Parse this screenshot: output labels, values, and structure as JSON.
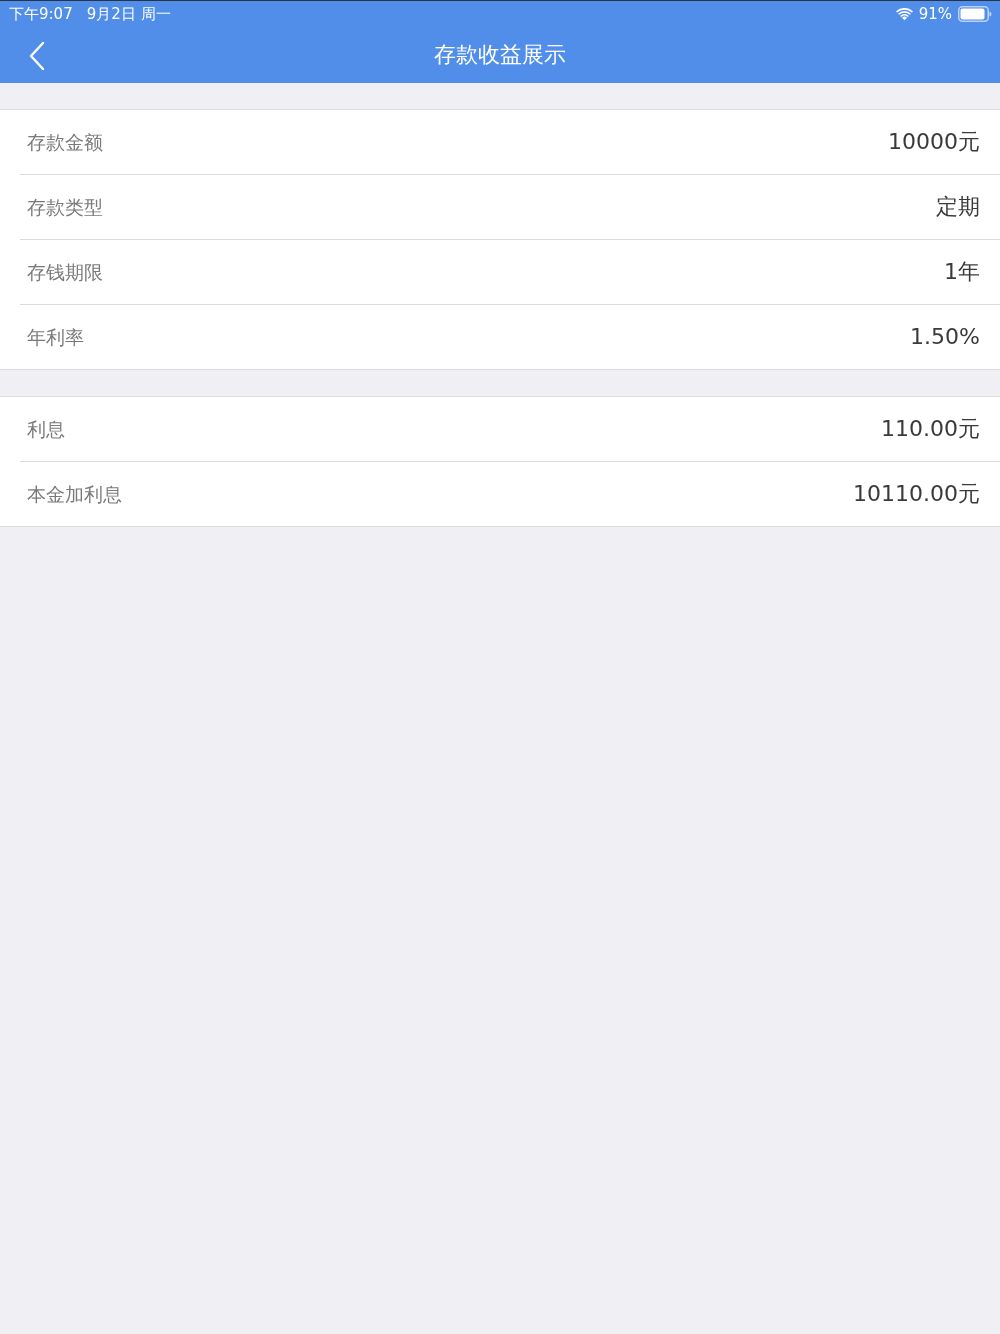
{
  "status_bar": {
    "time": "下午9:07",
    "date": "9月2日 周一",
    "battery": "91%"
  },
  "nav_bar": {
    "title": "存款收益展示"
  },
  "sections": [
    {
      "rows": [
        {
          "label": "存款金额",
          "value": "10000元"
        },
        {
          "label": "存款类型",
          "value": "定期"
        },
        {
          "label": "存钱期限",
          "value": "1年"
        },
        {
          "label": "年利率",
          "value": "1.50%"
        }
      ]
    },
    {
      "rows": [
        {
          "label": "利息",
          "value": "110.00元"
        },
        {
          "label": "本金加利息",
          "value": "10110.00元"
        }
      ]
    }
  ]
}
